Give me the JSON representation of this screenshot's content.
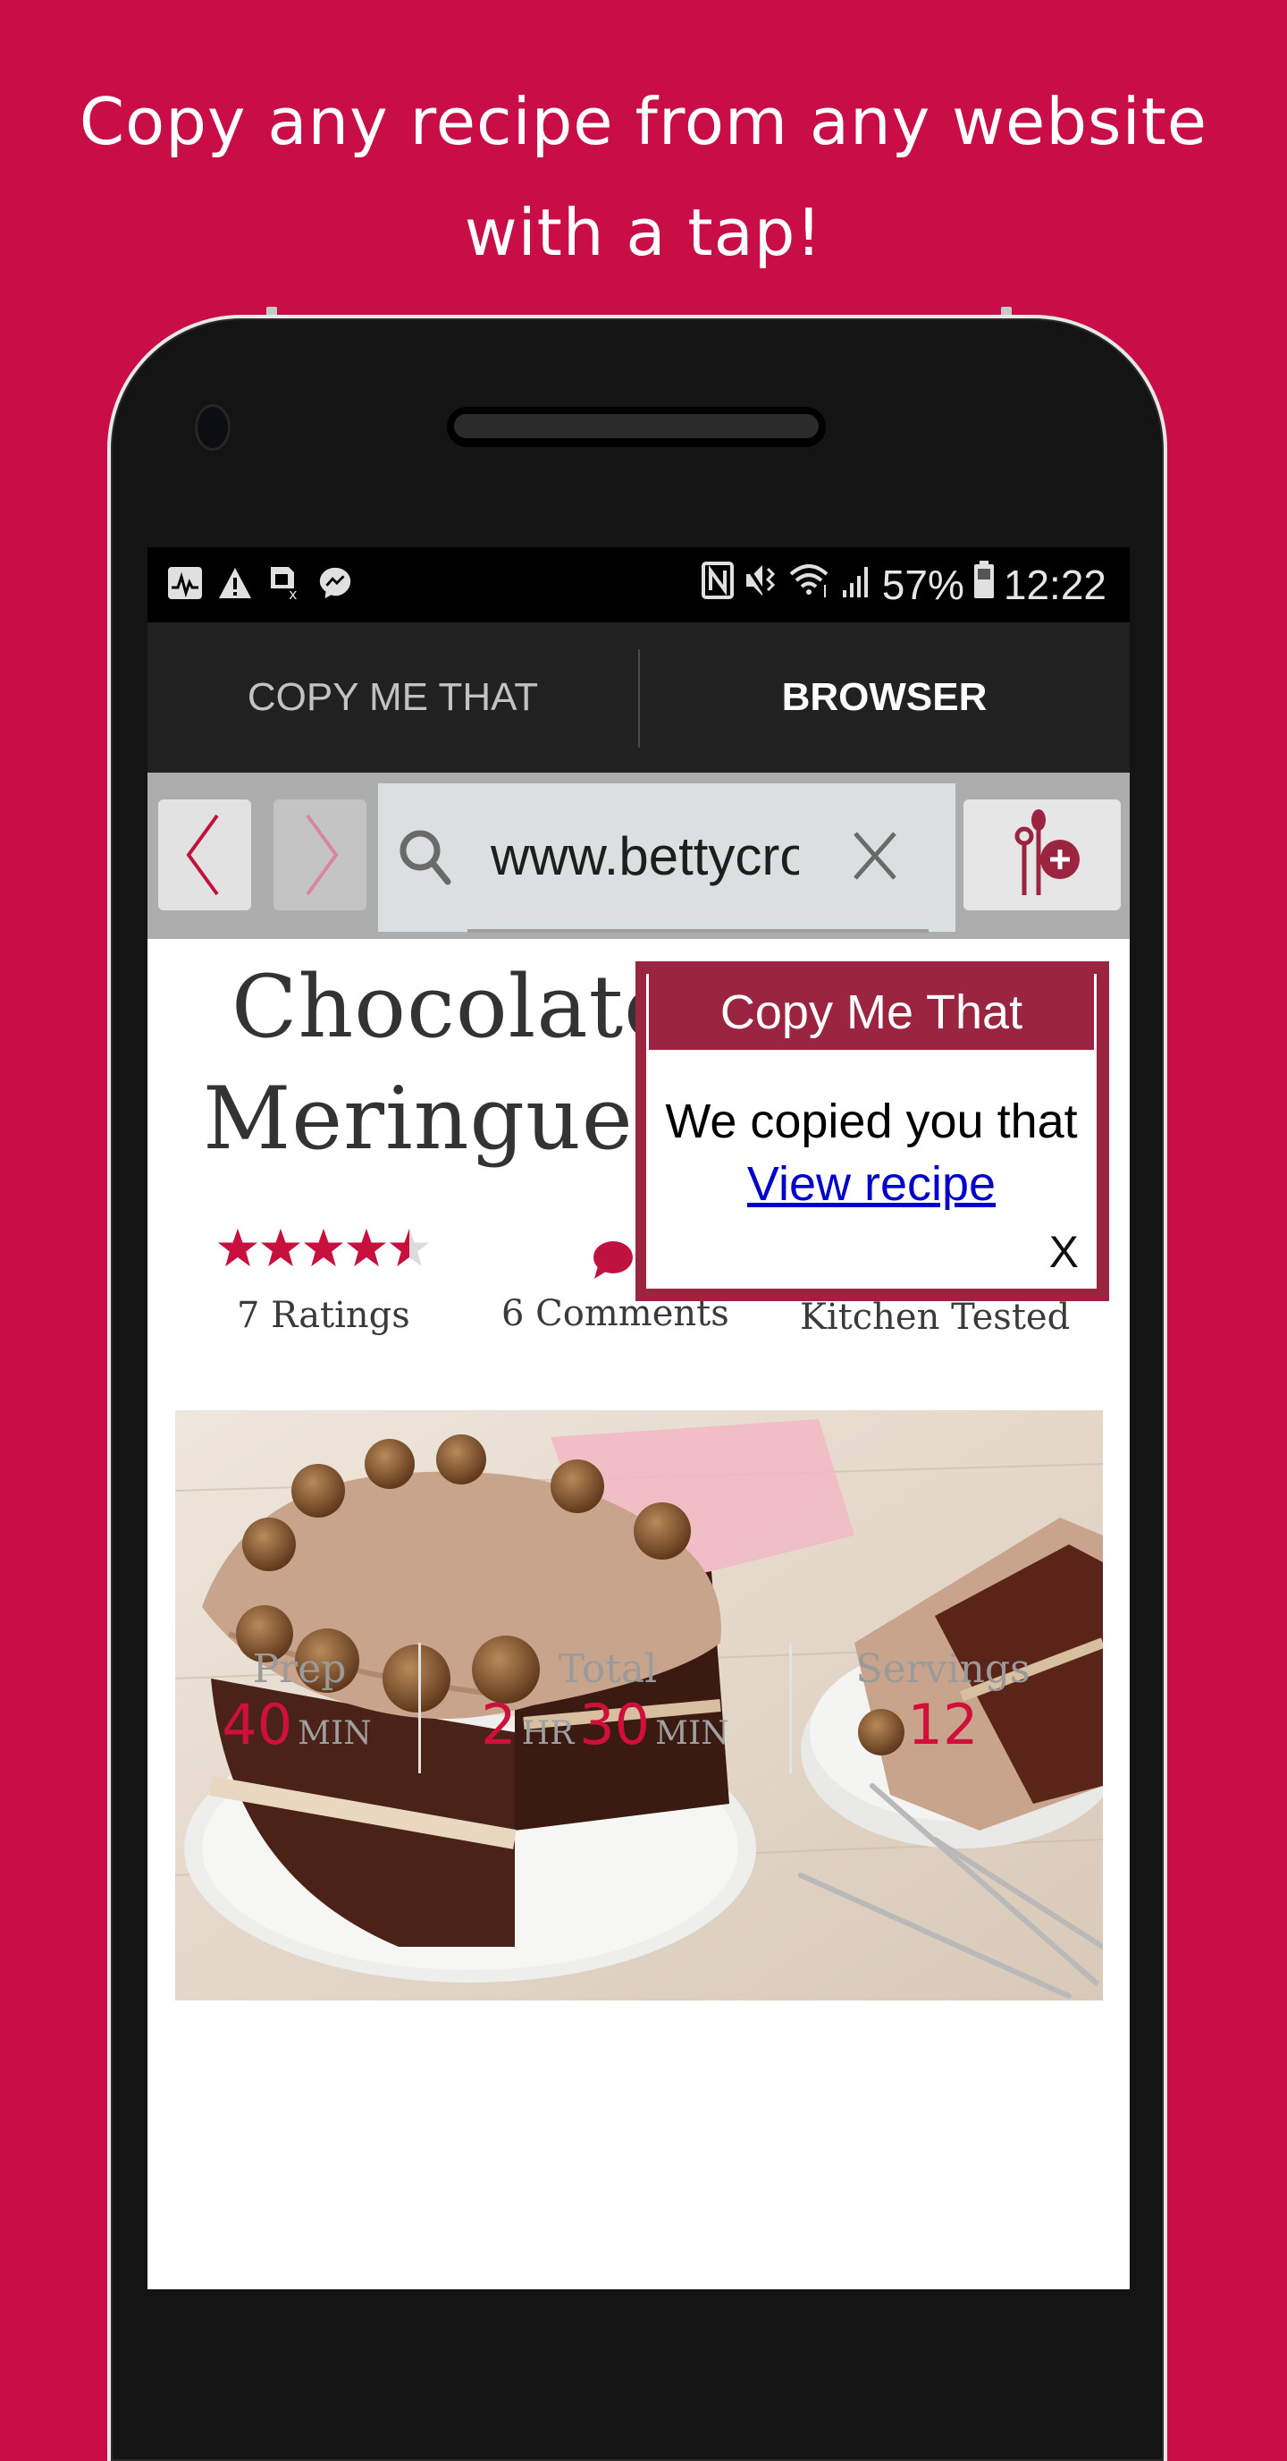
{
  "headline": {
    "line1": "Copy any recipe from any website",
    "line2": "with a tap!"
  },
  "colors": {
    "background": "#C90E47",
    "tab_indicator": "#0F9688",
    "popup": "#9B2540",
    "accent_red": "#D0103A",
    "link_blue": "#0000CC"
  },
  "status_bar": {
    "left_icons": [
      "health-monitor-icon",
      "warning-icon",
      "no-sim-icon",
      "messenger-icon"
    ],
    "right_icons": [
      "nfc-icon",
      "vibrate-icon",
      "wifi-icon",
      "signal-icon",
      "battery-icon"
    ],
    "battery": "57%",
    "time": "12:22"
  },
  "tabs": [
    {
      "label": "COPY ME THAT",
      "active": false
    },
    {
      "label": "BROWSER",
      "active": true
    }
  ],
  "browser": {
    "url": "www.bettycrocker.com",
    "back_icon": "chevron-left-icon",
    "forward_icon": "chevron-right-icon",
    "search_icon": "search-icon",
    "clear_icon": "close-icon",
    "copy_icon": "copy-recipe-add-icon"
  },
  "recipe": {
    "title_line1": "Chocolate",
    "title_line2": "Meringue",
    "rating": 4.5,
    "rating_max": 5,
    "ratings_label": "7 Ratings",
    "comments_label": "6 Comments",
    "tested_label": "Kitchen Tested",
    "image_alt": "Chocolate meringue layer cake with hazelnut chocolates and a slice on a plate",
    "stats": {
      "prep": {
        "label": "Prep",
        "value": "40",
        "unit": "MIN"
      },
      "total": {
        "label": "Total",
        "hours": "2",
        "hours_unit": "HR",
        "minutes": "30",
        "minutes_unit": "MIN"
      },
      "servings": {
        "label": "Servings",
        "value": "12"
      }
    }
  },
  "popup": {
    "title": "Copy Me That",
    "message": "We copied you that",
    "link": "View recipe",
    "close": "X"
  }
}
